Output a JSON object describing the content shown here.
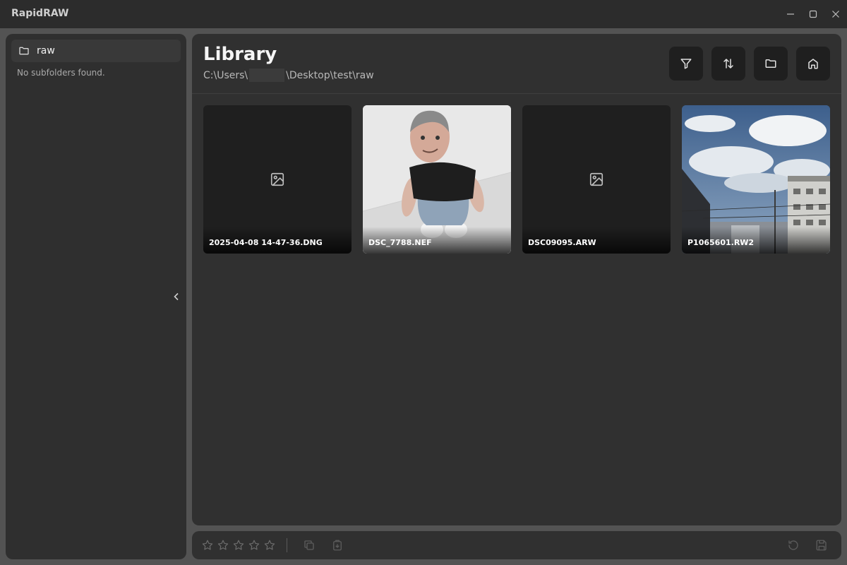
{
  "window": {
    "title": "RapidRAW"
  },
  "sidebar": {
    "folder": {
      "label": "raw",
      "icon": "folder-icon"
    },
    "empty_text": "No subfolders found."
  },
  "library": {
    "title": "Library",
    "path": {
      "prefix": "C:\\Users\\",
      "suffix": "\\Desktop\\test\\raw"
    },
    "toolbar": [
      "filter-icon",
      "sort-icon",
      "folder-icon",
      "home-icon"
    ]
  },
  "images": [
    {
      "name": "2025-04-08 14-47-36.DNG",
      "preview": "placeholder"
    },
    {
      "name": "DSC_7788.NEF",
      "preview": "plush doll photo"
    },
    {
      "name": "DSC09095.ARW",
      "preview": "placeholder"
    },
    {
      "name": "P1065601.RW2",
      "preview": "sky and buildings photo"
    }
  ],
  "bottombar": {
    "rating": 0,
    "max_rating": 5
  },
  "colors": {
    "background": "#535353",
    "panel": "#303030",
    "button": "#1f1f1f",
    "text": "#e8e8e8"
  }
}
